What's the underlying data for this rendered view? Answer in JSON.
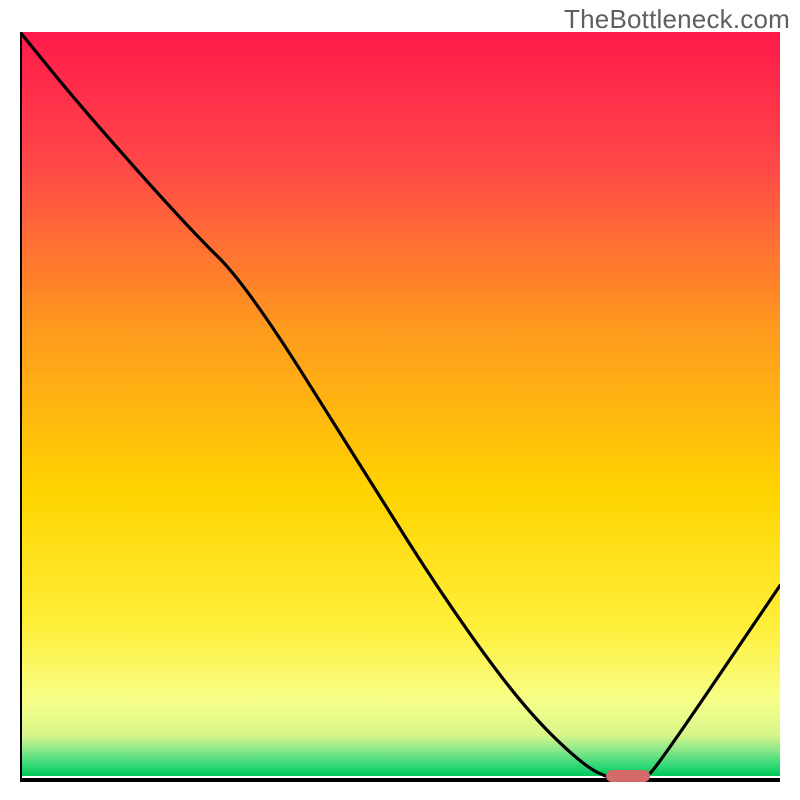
{
  "watermark": "TheBottleneck.com",
  "colors": {
    "axis": "#000000",
    "curve": "#000000",
    "marker_fill": "#d46a6a",
    "marker_stroke": "#c95b5b",
    "grad_top": "#ff1a4b",
    "grad_mid1": "#ff8a00",
    "grad_mid2": "#ffe600",
    "grad_low": "#fbff8a",
    "grad_green1": "#9de89d",
    "grad_green2": "#00d860"
  },
  "chart_data": {
    "type": "line",
    "title": "",
    "xlabel": "",
    "ylabel": "",
    "xlim": [
      0,
      100
    ],
    "ylim": [
      0,
      100
    ],
    "x": [
      0,
      8,
      22,
      30,
      46,
      56,
      66,
      74,
      78,
      82,
      84,
      100
    ],
    "values": [
      100,
      90,
      74,
      66,
      40,
      24,
      10,
      2,
      0,
      0,
      2,
      26
    ],
    "optimum_x": 80,
    "annotations": []
  }
}
